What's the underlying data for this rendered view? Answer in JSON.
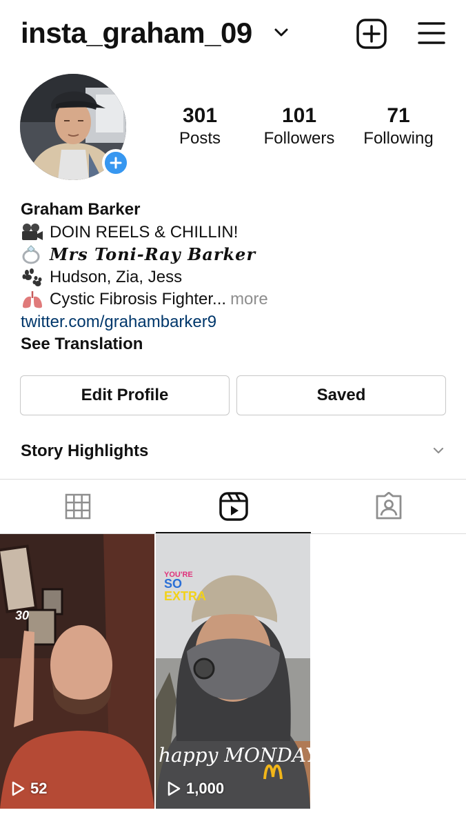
{
  "header": {
    "username": "insta_graham_09",
    "icons": [
      "chevron-down-icon",
      "new-post-icon",
      "hamburger-menu-icon"
    ]
  },
  "profile": {
    "avatar_icon": "avatar",
    "add_story_icon": "plus-icon",
    "stats": [
      {
        "value": "301",
        "label": "Posts"
      },
      {
        "value": "101",
        "label": "Followers"
      },
      {
        "value": "71",
        "label": "Following"
      }
    ]
  },
  "bio": {
    "name": "Graham Barker",
    "lines": [
      {
        "icon": "movie-camera-icon",
        "text": "DOIN REELS & CHILLIN!"
      },
      {
        "icon": "ring-icon",
        "text": "Mrs Toni-Ray Barker"
      },
      {
        "icon": "paw-prints-icon",
        "text": "Hudson, Zia, Jess"
      },
      {
        "icon": "lungs-icon",
        "text": "Cystic Fibrosis Fighter...",
        "more": "more"
      }
    ],
    "link": "twitter.com/grahambarker9",
    "see_translation": "See Translation"
  },
  "actions": {
    "edit_profile": "Edit Profile",
    "saved": "Saved"
  },
  "highlights": {
    "label": "Story Highlights"
  },
  "tabs": [
    {
      "icon": "grid-icon",
      "active": false
    },
    {
      "icon": "reels-icon",
      "active": true
    },
    {
      "icon": "tagged-icon",
      "active": false
    }
  ],
  "reels": [
    {
      "overlay_text": "30",
      "views": "52"
    },
    {
      "overlay_text": "YOU'RE SO EXTRA",
      "caption": "happy MONDAY",
      "views": "1,000"
    }
  ],
  "colors": {
    "accent_blue": "#3797f0",
    "link": "#00376b",
    "muted": "#8e8e8e",
    "border": "#dbdbdb"
  }
}
